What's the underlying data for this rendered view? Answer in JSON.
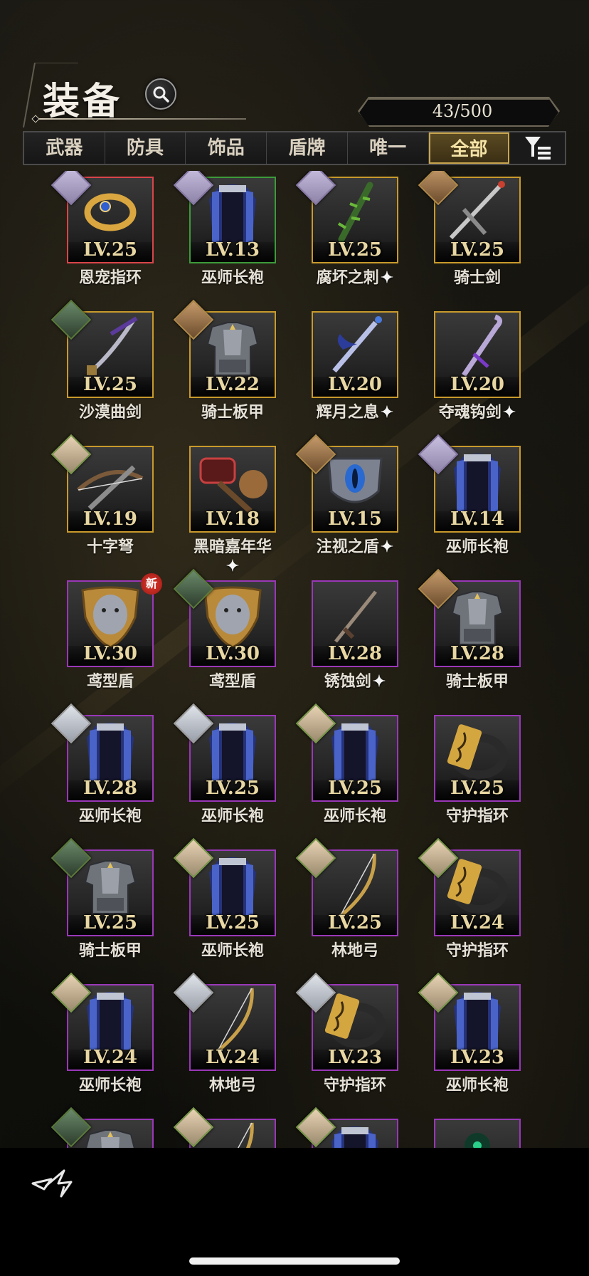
{
  "header": {
    "title": "装备",
    "count": "43/500"
  },
  "tabs": [
    {
      "label": "武器",
      "active": false
    },
    {
      "label": "防具",
      "active": false
    },
    {
      "label": "饰品",
      "active": false
    },
    {
      "label": "盾牌",
      "active": false
    },
    {
      "label": "唯一",
      "active": false
    },
    {
      "label": "全部",
      "active": true
    }
  ],
  "colors": {
    "gold_frame": "#c89a2c",
    "purple_frame": "#9a37b8",
    "red_frame": "#d8454a",
    "green_frame": "#3d9a3a",
    "active_tab": "#c9a54e"
  },
  "items": [
    {
      "level": "LV.25",
      "name": "恩宠指环",
      "rarity": "red",
      "portrait": "purple",
      "icon": "ring-icon",
      "special": false,
      "new": false
    },
    {
      "level": "LV.13",
      "name": "巫师长袍",
      "rarity": "green",
      "portrait": "purple",
      "icon": "robe-icon",
      "special": false,
      "new": false
    },
    {
      "level": "LV.25",
      "name": "腐坏之刺",
      "rarity": "gold",
      "portrait": "purple",
      "icon": "thorn-blade-icon",
      "special": true,
      "new": false
    },
    {
      "level": "LV.25",
      "name": "骑士剑",
      "rarity": "gold",
      "portrait": "gold",
      "icon": "sword-icon",
      "special": false,
      "new": false
    },
    {
      "level": "LV.25",
      "name": "沙漠曲剑",
      "rarity": "gold",
      "portrait": "green",
      "icon": "scimitar-icon",
      "special": false,
      "new": false
    },
    {
      "level": "LV.22",
      "name": "骑士板甲",
      "rarity": "gold",
      "portrait": "gold",
      "icon": "plate-armor-icon",
      "special": false,
      "new": false
    },
    {
      "level": "LV.20",
      "name": "辉月之息",
      "rarity": "gold",
      "portrait": "none",
      "icon": "moon-sword-icon",
      "special": true,
      "new": false
    },
    {
      "level": "LV.20",
      "name": "夺魂钩剑",
      "rarity": "gold",
      "portrait": "none",
      "icon": "hook-sword-icon",
      "special": true,
      "new": false
    },
    {
      "level": "LV.19",
      "name": "十字弩",
      "rarity": "gold",
      "portrait": "flower",
      "icon": "crossbow-icon",
      "special": false,
      "new": false
    },
    {
      "level": "LV.18",
      "name": "黑暗嘉年华",
      "rarity": "gold",
      "portrait": "none",
      "icon": "hammer-icon",
      "special": true,
      "new": false
    },
    {
      "level": "LV.15",
      "name": "注视之盾",
      "rarity": "gold",
      "portrait": "gold",
      "icon": "eye-shield-icon",
      "special": true,
      "new": false
    },
    {
      "level": "LV.14",
      "name": "巫师长袍",
      "rarity": "gold",
      "portrait": "purple",
      "icon": "robe-icon",
      "special": false,
      "new": false
    },
    {
      "level": "LV.30",
      "name": "鸢型盾",
      "rarity": "purple",
      "portrait": "none",
      "icon": "kite-shield-icon",
      "special": false,
      "new": true
    },
    {
      "level": "LV.30",
      "name": "鸢型盾",
      "rarity": "purple",
      "portrait": "green",
      "icon": "kite-shield-icon",
      "special": false,
      "new": false
    },
    {
      "level": "LV.28",
      "name": "锈蚀剑",
      "rarity": "purple",
      "portrait": "none",
      "icon": "rusty-sword-icon",
      "special": true,
      "new": false
    },
    {
      "level": "LV.28",
      "name": "骑士板甲",
      "rarity": "purple",
      "portrait": "gold",
      "icon": "plate-armor-icon",
      "special": false,
      "new": false
    },
    {
      "level": "LV.28",
      "name": "巫师长袍",
      "rarity": "purple",
      "portrait": "silver",
      "icon": "robe-icon",
      "special": false,
      "new": false
    },
    {
      "level": "LV.25",
      "name": "巫师长袍",
      "rarity": "purple",
      "portrait": "silver",
      "icon": "robe-icon",
      "special": false,
      "new": false
    },
    {
      "level": "LV.25",
      "name": "巫师长袍",
      "rarity": "purple",
      "portrait": "flower",
      "icon": "robe-icon",
      "special": false,
      "new": false
    },
    {
      "level": "LV.25",
      "name": "守护指环",
      "rarity": "purple",
      "portrait": "none",
      "icon": "guard-ring-icon",
      "special": false,
      "new": false
    },
    {
      "level": "LV.25",
      "name": "骑士板甲",
      "rarity": "purple",
      "portrait": "green",
      "icon": "plate-armor-icon",
      "special": false,
      "new": false
    },
    {
      "level": "LV.25",
      "name": "巫师长袍",
      "rarity": "purple",
      "portrait": "flower",
      "icon": "robe-icon",
      "special": false,
      "new": false
    },
    {
      "level": "LV.25",
      "name": "林地弓",
      "rarity": "purple",
      "portrait": "flower",
      "icon": "bow-icon",
      "special": false,
      "new": false
    },
    {
      "level": "LV.24",
      "name": "守护指环",
      "rarity": "purple",
      "portrait": "flower",
      "icon": "guard-ring-icon",
      "special": false,
      "new": false
    },
    {
      "level": "LV.24",
      "name": "巫师长袍",
      "rarity": "purple",
      "portrait": "flower",
      "icon": "robe-icon",
      "special": false,
      "new": false
    },
    {
      "level": "LV.24",
      "name": "林地弓",
      "rarity": "purple",
      "portrait": "silver",
      "icon": "bow-icon",
      "special": false,
      "new": false
    },
    {
      "level": "LV.23",
      "name": "守护指环",
      "rarity": "purple",
      "portrait": "silver",
      "icon": "guard-ring-icon",
      "special": false,
      "new": false
    },
    {
      "level": "LV.23",
      "name": "巫师长袍",
      "rarity": "purple",
      "portrait": "flower",
      "icon": "robe-icon",
      "special": false,
      "new": false
    },
    {
      "level": "",
      "name": "",
      "rarity": "purple",
      "portrait": "green",
      "icon": "plate-armor-icon",
      "special": false,
      "new": false
    },
    {
      "level": "",
      "name": "",
      "rarity": "purple",
      "portrait": "flower",
      "icon": "bow-icon",
      "special": false,
      "new": false
    },
    {
      "level": "",
      "name": "",
      "rarity": "purple",
      "portrait": "flower",
      "icon": "robe-icon",
      "special": false,
      "new": false
    },
    {
      "level": "",
      "name": "",
      "rarity": "purple",
      "portrait": "none",
      "icon": "magic-item-icon",
      "special": false,
      "new": false
    }
  ],
  "labels": {
    "new_badge": "新",
    "special_mark": "✦"
  }
}
